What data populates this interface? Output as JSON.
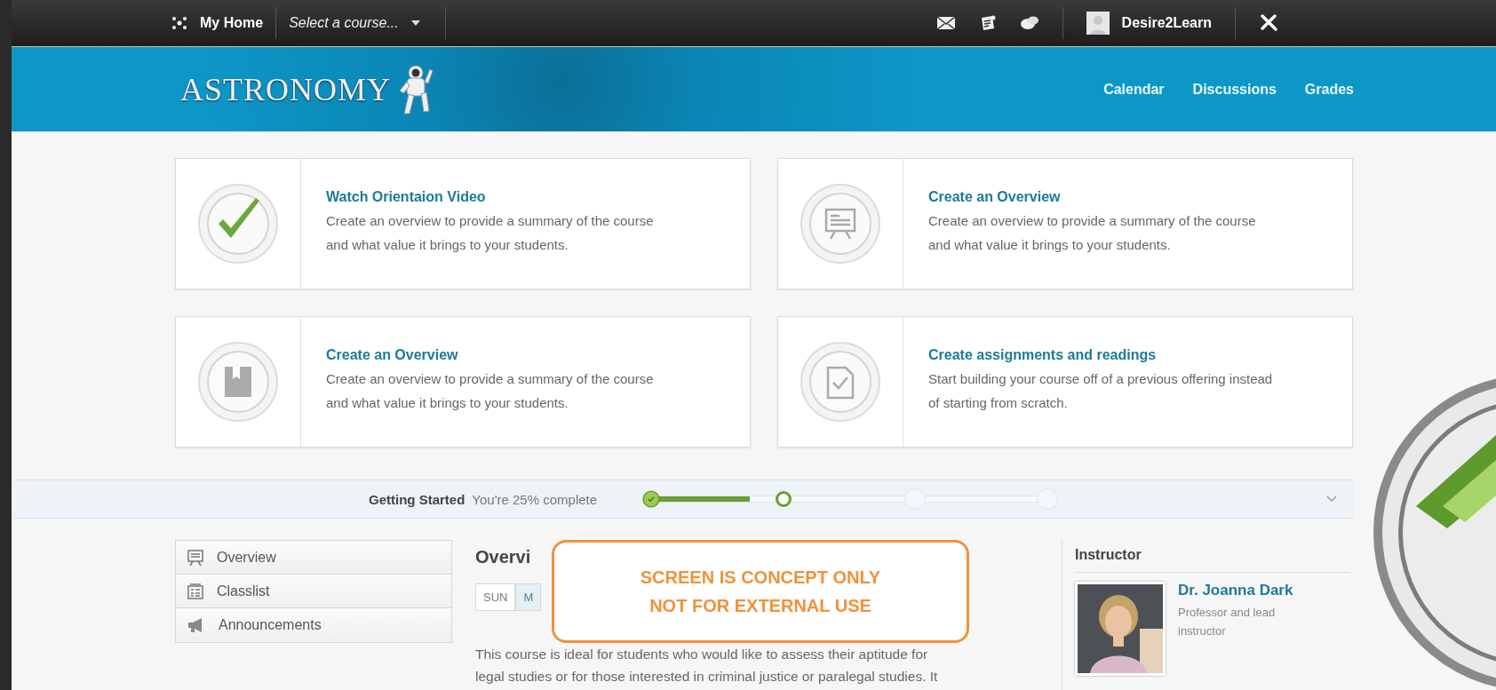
{
  "top_bar": {
    "home": "My Home",
    "course_select": {
      "placeholder": "Select a course..."
    },
    "user": "Desire2Learn"
  },
  "banner": {
    "title": "ASTRONOMY",
    "nav": [
      "Calendar",
      "Discussions",
      "Grades"
    ]
  },
  "cards": [
    {
      "kind": "check",
      "title": "Watch Orientaion Video",
      "text": "Create an overview to provide a summary of the course and what value it brings to your students."
    },
    {
      "kind": "presentation",
      "title": "Create an Overview",
      "text": "Create an overview to provide a summary of the course and what value it brings to your students."
    },
    {
      "kind": "book",
      "title": "Create an Overview",
      "text": "Create an overview to provide a summary of the course and what value it brings to your students."
    },
    {
      "kind": "checklist",
      "title": "Create assignments and readings",
      "text": "Start building your course off of a previous offering instead of starting from scratch."
    }
  ],
  "progress": {
    "label": "Getting Started",
    "status": "You're 25% complete",
    "level": 0.25,
    "steps": [
      {
        "kind": "done"
      },
      {
        "kind": "current"
      },
      {
        "kind": "pending"
      },
      {
        "kind": "pending"
      }
    ]
  },
  "sidebar": {
    "items": [
      {
        "kind": "overview",
        "label": "Overview"
      },
      {
        "kind": "classlist",
        "label": "Classlist"
      },
      {
        "kind": "announcements",
        "label": "Announcements"
      }
    ]
  },
  "main": {
    "heading": "Overvi",
    "day_tabs": [
      {
        "label": "SUN",
        "selected": false
      },
      {
        "label": "M",
        "selected": true
      }
    ],
    "lines": [
      "This course is ideal for students who would like to assess their aptitude for",
      "legal studies or for those interested in criminal justice or paralegal studies. It"
    ]
  },
  "notice": [
    "SCREEN IS CONCEPT ONLY",
    "NOT FOR EXTERNAL USE"
  ],
  "instructor": {
    "heading": "Instructor",
    "name": "Dr. Joanna Dark",
    "role": "Professor and lead instructor"
  }
}
